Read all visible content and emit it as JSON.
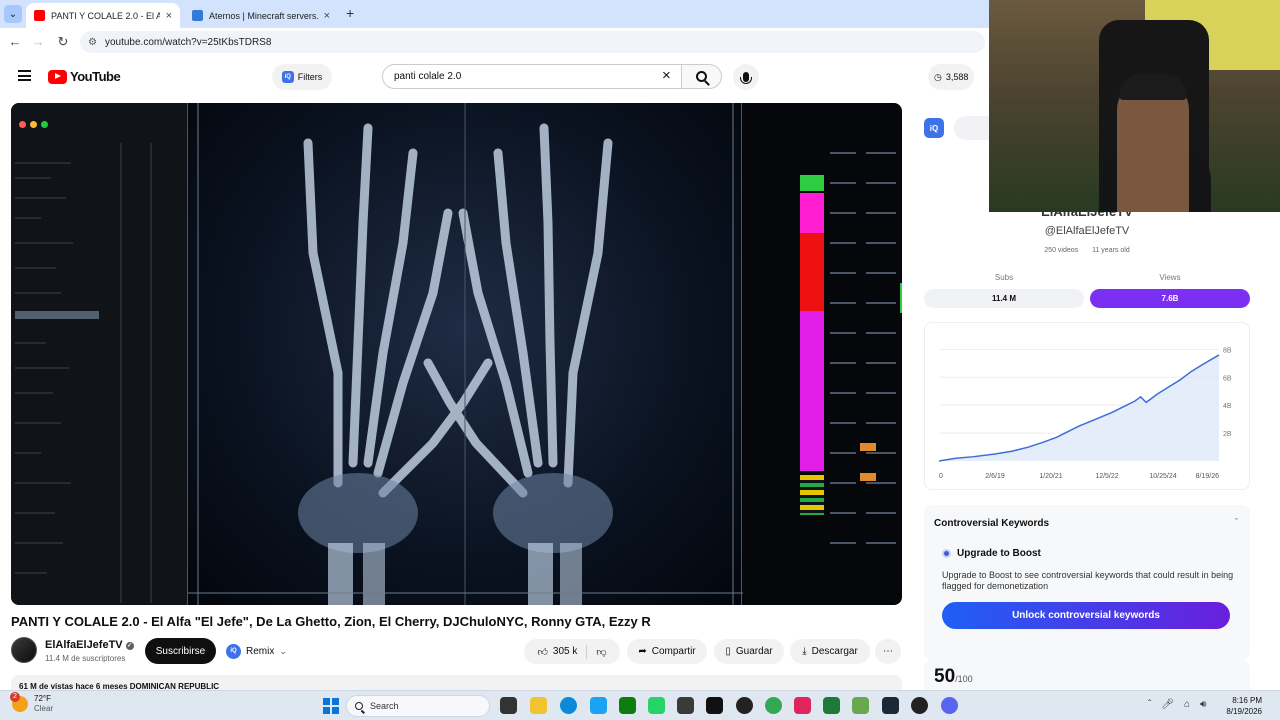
{
  "browser": {
    "tabs": [
      {
        "title": "PANTI Y COLALE 2.0 - El Alfa \"E",
        "favicon_color": "#ff0000",
        "active": true
      },
      {
        "title": "Aternos | Minecraft servers. Free",
        "favicon_color": "#2f7bd6",
        "active": false
      }
    ],
    "url": "youtube.com/watch?v=25tKbsTDRS8"
  },
  "youtube": {
    "logo_text": "YouTube",
    "filters_label": "Filters",
    "search_query": "panti colale 2.0",
    "header_count": "3,588"
  },
  "video": {
    "title": "PANTI Y COLALE 2.0 - El Alfa \"El Jefe\", De La Ghetto, Zion, El Cherry, DJChuloNYC, Ronny GTA, Ezzy R",
    "channel_name": "ElAlfaElJefeTV",
    "subscribers": "11.4 M de suscriptores",
    "subscribe_label": "Suscribirse",
    "remix_label": "Remix",
    "likes": "305 k",
    "share_label": "Compartir",
    "save_label": "Guardar",
    "download_label": "Descargar",
    "description_preview": "61 M de vistas  hace 6 meses  DOMINICAN REPUBLIC"
  },
  "panel": {
    "channel_name": "ElAlfaElJefeTV",
    "handle": "@ElAlfaElJefeTV",
    "videos": "250 videos",
    "age": "11 years old",
    "subs_label": "Subs",
    "subs_value": "11.4 M",
    "views_label": "Views",
    "views_value": "7.6B",
    "views_accent": "#7b2ff2",
    "keywords_title": "Controversial Keywords",
    "boost_title": "Upgrade to Boost",
    "boost_text": "Upgrade to Boost to see controversial keywords that could result in being flagged for demonetization",
    "unlock_label": "Unlock controversial keywords",
    "score": "50",
    "score_max": "/100"
  },
  "chart_data": {
    "type": "area",
    "title": "",
    "x_ticks": [
      "0",
      "2/6/19",
      "1/20/21",
      "12/5/22",
      "10/25/24",
      "8/19/26"
    ],
    "y_ticks": [
      "2B",
      "4B",
      "6B",
      "8B"
    ],
    "ylim": [
      0,
      8.6
    ],
    "series": [
      {
        "x": [
          0,
          0.6,
          1.2,
          2.0,
          2.6,
          3.2,
          3.8,
          4.2,
          4.6,
          5.0,
          5.6,
          6.2,
          6.6,
          7.0,
          7.2,
          7.4,
          7.8,
          8.2,
          8.6,
          9.0,
          9.4,
          10.0
        ],
        "values": [
          0.0,
          0.2,
          0.3,
          0.5,
          0.7,
          1.0,
          1.4,
          1.7,
          2.1,
          2.5,
          3.0,
          3.5,
          3.9,
          4.3,
          4.6,
          4.2,
          4.8,
          5.3,
          5.8,
          6.4,
          6.9,
          7.6
        ]
      }
    ],
    "grid": "horizontal",
    "color": "#3b6fd6"
  },
  "taskbar": {
    "temperature": "72°F",
    "condition": "Clear",
    "notification_count": "2",
    "search_label": "Search",
    "time": "8:16 PM",
    "date": "8/19/2026"
  }
}
